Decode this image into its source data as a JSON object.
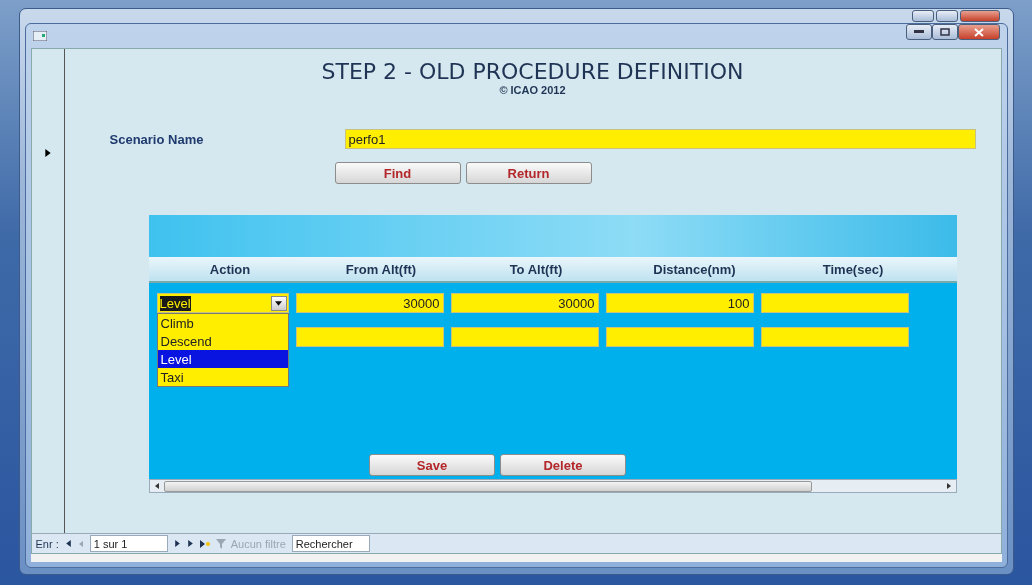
{
  "form": {
    "title": "STEP 2 - OLD PROCEDURE DEFINITION",
    "copyright": "© ICAO 2012",
    "scenario_label": "Scenario Name",
    "scenario_value": "perfo1",
    "buttons": [
      "Find",
      "Return"
    ]
  },
  "subform": {
    "columns": [
      "Action",
      "From Alt(ft)",
      "To Alt(ft)",
      "Distance(nm)",
      "Time(sec)"
    ],
    "rows": [
      {
        "kind": "record",
        "action": "Level",
        "action_highlighted": true,
        "from_alt": "30000",
        "to_alt": "30000",
        "distance": "100"
      },
      {
        "kind": "new"
      }
    ],
    "dropdown": {
      "options": [
        {
          "label": "Climb",
          "selected": false
        },
        {
          "label": "Descend",
          "selected": false
        },
        {
          "label": "Level",
          "selected": true
        },
        {
          "label": "Taxi",
          "selected": false
        }
      ]
    },
    "buttons": [
      "Save",
      "Delete"
    ]
  },
  "navigation": {
    "label": "Enr :",
    "position": "1 sur 1",
    "filter": {
      "label": "Aucun filtre",
      "disabled": true
    },
    "search": "Rechercher"
  }
}
